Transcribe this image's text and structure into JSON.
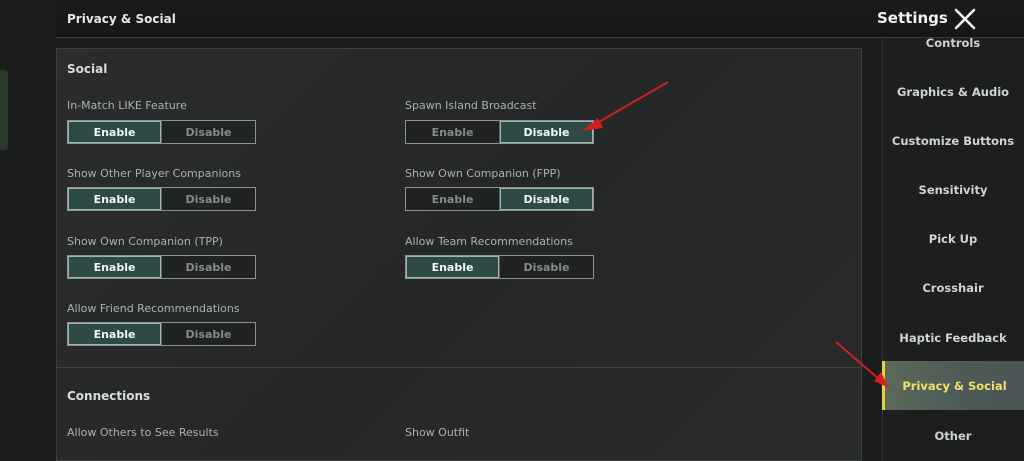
{
  "header": {
    "page_title": "Privacy & Social",
    "settings_title": "Settings",
    "close_icon": "close-icon"
  },
  "sections": {
    "social": {
      "title": "Social",
      "settings": [
        {
          "label": "In-Match LIKE Feature",
          "options": [
            "Enable",
            "Disable"
          ],
          "selected": "Enable"
        },
        {
          "label": "Spawn Island Broadcast",
          "options": [
            "Enable",
            "Disable"
          ],
          "selected": "Disable"
        },
        {
          "label": "Show Other Player Companions",
          "options": [
            "Enable",
            "Disable"
          ],
          "selected": "Enable"
        },
        {
          "label": "Show Own Companion (FPP)",
          "options": [
            "Enable",
            "Disable"
          ],
          "selected": "Disable"
        },
        {
          "label": "Show Own Companion (TPP)",
          "options": [
            "Enable",
            "Disable"
          ],
          "selected": "Enable"
        },
        {
          "label": "Allow Team Recommendations",
          "options": [
            "Enable",
            "Disable"
          ],
          "selected": "Enable"
        },
        {
          "label": "Allow Friend Recommendations",
          "options": [
            "Enable",
            "Disable"
          ],
          "selected": "Enable"
        }
      ]
    },
    "connections": {
      "title": "Connections",
      "settings": [
        {
          "label": "Allow Others to See Results"
        },
        {
          "label": "Show Outfit"
        }
      ]
    }
  },
  "sidebar": {
    "items": [
      {
        "label": "Controls"
      },
      {
        "label": "Graphics & Audio"
      },
      {
        "label": "Customize Buttons"
      },
      {
        "label": "Sensitivity"
      },
      {
        "label": "Pick Up"
      },
      {
        "label": "Crosshair"
      },
      {
        "label": "Haptic Feedback"
      },
      {
        "label": "Privacy & Social"
      },
      {
        "label": "Other"
      }
    ],
    "active": "Privacy & Social"
  },
  "colors": {
    "selected_option": "#2e4a46",
    "active_tab_text": "#f0e06a",
    "annotation_arrow": "#d21f1f"
  }
}
